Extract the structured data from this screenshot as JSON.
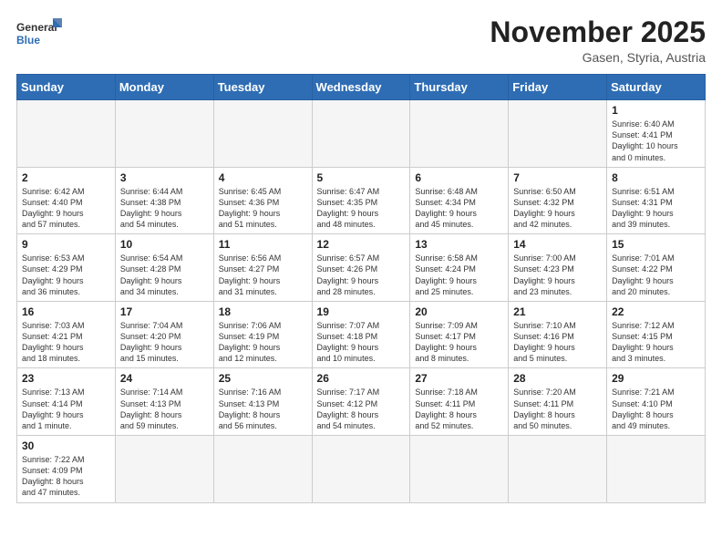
{
  "header": {
    "logo_general": "General",
    "logo_blue": "Blue",
    "month_title": "November 2025",
    "location": "Gasen, Styria, Austria"
  },
  "weekdays": [
    "Sunday",
    "Monday",
    "Tuesday",
    "Wednesday",
    "Thursday",
    "Friday",
    "Saturday"
  ],
  "weeks": [
    [
      {
        "day": "",
        "info": ""
      },
      {
        "day": "",
        "info": ""
      },
      {
        "day": "",
        "info": ""
      },
      {
        "day": "",
        "info": ""
      },
      {
        "day": "",
        "info": ""
      },
      {
        "day": "",
        "info": ""
      },
      {
        "day": "1",
        "info": "Sunrise: 6:40 AM\nSunset: 4:41 PM\nDaylight: 10 hours\nand 0 minutes."
      }
    ],
    [
      {
        "day": "2",
        "info": "Sunrise: 6:42 AM\nSunset: 4:40 PM\nDaylight: 9 hours\nand 57 minutes."
      },
      {
        "day": "3",
        "info": "Sunrise: 6:44 AM\nSunset: 4:38 PM\nDaylight: 9 hours\nand 54 minutes."
      },
      {
        "day": "4",
        "info": "Sunrise: 6:45 AM\nSunset: 4:36 PM\nDaylight: 9 hours\nand 51 minutes."
      },
      {
        "day": "5",
        "info": "Sunrise: 6:47 AM\nSunset: 4:35 PM\nDaylight: 9 hours\nand 48 minutes."
      },
      {
        "day": "6",
        "info": "Sunrise: 6:48 AM\nSunset: 4:34 PM\nDaylight: 9 hours\nand 45 minutes."
      },
      {
        "day": "7",
        "info": "Sunrise: 6:50 AM\nSunset: 4:32 PM\nDaylight: 9 hours\nand 42 minutes."
      },
      {
        "day": "8",
        "info": "Sunrise: 6:51 AM\nSunset: 4:31 PM\nDaylight: 9 hours\nand 39 minutes."
      }
    ],
    [
      {
        "day": "9",
        "info": "Sunrise: 6:53 AM\nSunset: 4:29 PM\nDaylight: 9 hours\nand 36 minutes."
      },
      {
        "day": "10",
        "info": "Sunrise: 6:54 AM\nSunset: 4:28 PM\nDaylight: 9 hours\nand 34 minutes."
      },
      {
        "day": "11",
        "info": "Sunrise: 6:56 AM\nSunset: 4:27 PM\nDaylight: 9 hours\nand 31 minutes."
      },
      {
        "day": "12",
        "info": "Sunrise: 6:57 AM\nSunset: 4:26 PM\nDaylight: 9 hours\nand 28 minutes."
      },
      {
        "day": "13",
        "info": "Sunrise: 6:58 AM\nSunset: 4:24 PM\nDaylight: 9 hours\nand 25 minutes."
      },
      {
        "day": "14",
        "info": "Sunrise: 7:00 AM\nSunset: 4:23 PM\nDaylight: 9 hours\nand 23 minutes."
      },
      {
        "day": "15",
        "info": "Sunrise: 7:01 AM\nSunset: 4:22 PM\nDaylight: 9 hours\nand 20 minutes."
      }
    ],
    [
      {
        "day": "16",
        "info": "Sunrise: 7:03 AM\nSunset: 4:21 PM\nDaylight: 9 hours\nand 18 minutes."
      },
      {
        "day": "17",
        "info": "Sunrise: 7:04 AM\nSunset: 4:20 PM\nDaylight: 9 hours\nand 15 minutes."
      },
      {
        "day": "18",
        "info": "Sunrise: 7:06 AM\nSunset: 4:19 PM\nDaylight: 9 hours\nand 12 minutes."
      },
      {
        "day": "19",
        "info": "Sunrise: 7:07 AM\nSunset: 4:18 PM\nDaylight: 9 hours\nand 10 minutes."
      },
      {
        "day": "20",
        "info": "Sunrise: 7:09 AM\nSunset: 4:17 PM\nDaylight: 9 hours\nand 8 minutes."
      },
      {
        "day": "21",
        "info": "Sunrise: 7:10 AM\nSunset: 4:16 PM\nDaylight: 9 hours\nand 5 minutes."
      },
      {
        "day": "22",
        "info": "Sunrise: 7:12 AM\nSunset: 4:15 PM\nDaylight: 9 hours\nand 3 minutes."
      }
    ],
    [
      {
        "day": "23",
        "info": "Sunrise: 7:13 AM\nSunset: 4:14 PM\nDaylight: 9 hours\nand 1 minute."
      },
      {
        "day": "24",
        "info": "Sunrise: 7:14 AM\nSunset: 4:13 PM\nDaylight: 8 hours\nand 59 minutes."
      },
      {
        "day": "25",
        "info": "Sunrise: 7:16 AM\nSunset: 4:13 PM\nDaylight: 8 hours\nand 56 minutes."
      },
      {
        "day": "26",
        "info": "Sunrise: 7:17 AM\nSunset: 4:12 PM\nDaylight: 8 hours\nand 54 minutes."
      },
      {
        "day": "27",
        "info": "Sunrise: 7:18 AM\nSunset: 4:11 PM\nDaylight: 8 hours\nand 52 minutes."
      },
      {
        "day": "28",
        "info": "Sunrise: 7:20 AM\nSunset: 4:11 PM\nDaylight: 8 hours\nand 50 minutes."
      },
      {
        "day": "29",
        "info": "Sunrise: 7:21 AM\nSunset: 4:10 PM\nDaylight: 8 hours\nand 49 minutes."
      }
    ],
    [
      {
        "day": "30",
        "info": "Sunrise: 7:22 AM\nSunset: 4:09 PM\nDaylight: 8 hours\nand 47 minutes."
      },
      {
        "day": "",
        "info": ""
      },
      {
        "day": "",
        "info": ""
      },
      {
        "day": "",
        "info": ""
      },
      {
        "day": "",
        "info": ""
      },
      {
        "day": "",
        "info": ""
      },
      {
        "day": "",
        "info": ""
      }
    ]
  ]
}
